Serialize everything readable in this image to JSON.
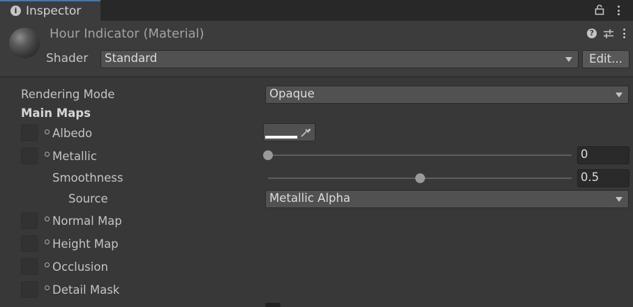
{
  "tab": {
    "title": "Inspector",
    "info_icon": "i"
  },
  "header": {
    "material_name": "Hour Indicator (Material)",
    "shader_label": "Shader",
    "shader_value": "Standard",
    "edit_button": "Edit...",
    "help_icon": "?"
  },
  "props": {
    "rendering_mode_label": "Rendering Mode",
    "rendering_mode_value": "Opaque",
    "main_maps_label": "Main Maps",
    "albedo_label": "Albedo",
    "albedo_color": "#ffffff",
    "metallic_label": "Metallic",
    "metallic_value": "0",
    "metallic_fraction": 0,
    "smoothness_label": "Smoothness",
    "smoothness_value": "0.5",
    "smoothness_fraction": 0.5,
    "source_label": "Source",
    "source_value": "Metallic Alpha",
    "normal_map_label": "Normal Map",
    "height_map_label": "Height Map",
    "occlusion_label": "Occlusion",
    "detail_mask_label": "Detail Mask"
  },
  "colors": {
    "tab_accent": "#3a79bb",
    "panel_bg": "#383838",
    "header_bg": "#3c3c3c"
  }
}
